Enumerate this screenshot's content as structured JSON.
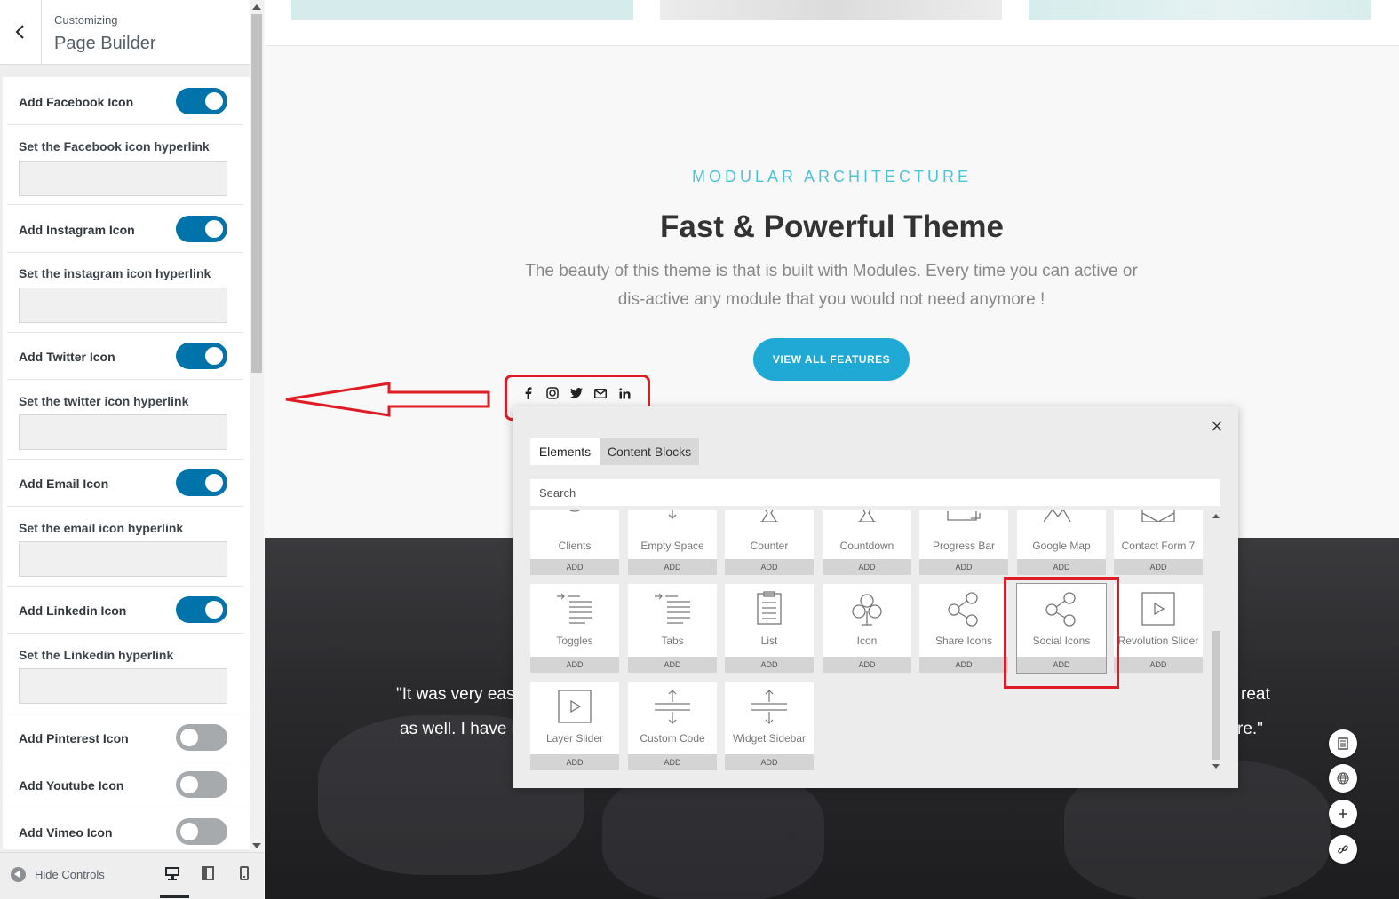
{
  "sidebar": {
    "breadcrumb": "Customizing",
    "title": "Page Builder",
    "settings": [
      {
        "type": "toggle",
        "label": "Add Facebook Icon",
        "on": true
      },
      {
        "type": "input",
        "label": "Set the Facebook icon hyperlink",
        "value": ""
      },
      {
        "type": "toggle",
        "label": "Add Instagram Icon",
        "on": true
      },
      {
        "type": "input",
        "label": "Set the instagram icon hyperlink",
        "value": ""
      },
      {
        "type": "toggle",
        "label": "Add Twitter Icon",
        "on": true
      },
      {
        "type": "input",
        "label": "Set the twitter icon hyperlink",
        "value": ""
      },
      {
        "type": "toggle",
        "label": "Add Email Icon",
        "on": true
      },
      {
        "type": "input",
        "label": "Set the email icon hyperlink",
        "value": ""
      },
      {
        "type": "toggle",
        "label": "Add Linkedin Icon",
        "on": true
      },
      {
        "type": "input",
        "label": "Set the Linkedin hyperlink",
        "value": ""
      },
      {
        "type": "toggle",
        "label": "Add Pinterest Icon",
        "on": false
      },
      {
        "type": "toggle",
        "label": "Add Youtube Icon",
        "on": false
      },
      {
        "type": "toggle",
        "label": "Add Vimeo Icon",
        "on": false
      }
    ],
    "footer": {
      "hide_controls": "Hide Controls"
    }
  },
  "preview": {
    "eyebrow": "MODULAR ARCHITECTURE",
    "headline": "Fast & Powerful Theme",
    "description": "The beauty of this theme is that is built with Modules. Every time you can active or dis-active any module that you would not need anymore !",
    "cta": "VIEW ALL FEATURES",
    "social_icons": [
      "facebook-icon",
      "instagram-icon",
      "twitter-icon",
      "email-icon",
      "linkedin-icon"
    ],
    "quote_line1_left": "\"It was very easy",
    "quote_line2_left": "as well. I have n",
    "quote_line1_right": "reat",
    "quote_line2_right": "re.\""
  },
  "modal": {
    "tabs": [
      "Elements",
      "Content Blocks"
    ],
    "active_tab": "Elements",
    "search_placeholder": "Search",
    "add_label": "ADD",
    "rows": [
      [
        "Clients",
        "Empty Space",
        "Counter",
        "Countdown",
        "Progress Bar",
        "Google Map",
        "Contact Form 7"
      ],
      [
        "Toggles",
        "Tabs",
        "List",
        "Icon",
        "Share Icons",
        "Social Icons",
        "Revolution Slider"
      ],
      [
        "Layer Slider",
        "Custom Code",
        "Widget Sidebar"
      ]
    ],
    "highlighted_element": "Social Icons"
  },
  "colors": {
    "toggle_on": "#0073aa",
    "toggle_off": "#a7aaad",
    "accent": "#1fa9d4",
    "eyebrow": "#4ec3d6",
    "annotation_red": "#e01b24"
  }
}
